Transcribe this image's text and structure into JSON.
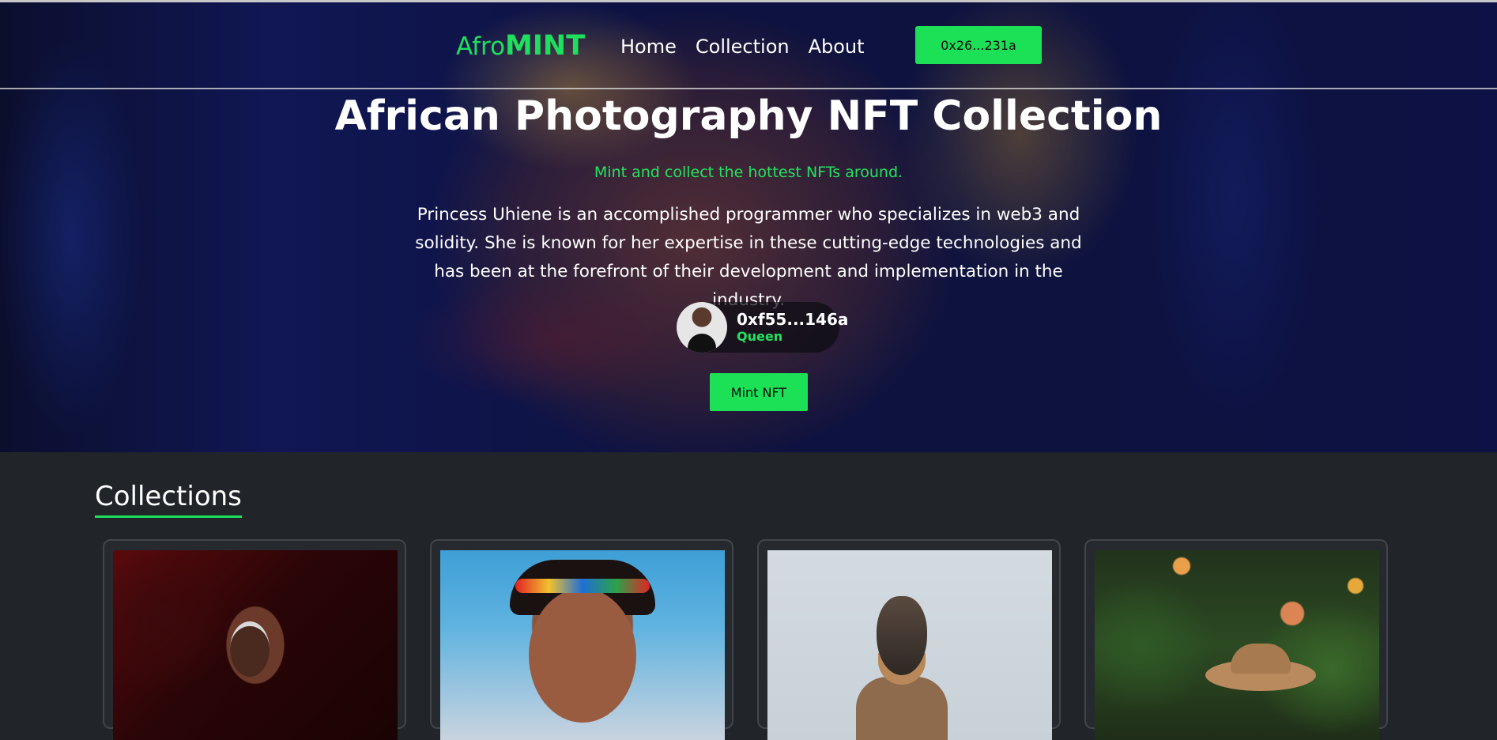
{
  "navbar": {
    "brand_part1": "Afro",
    "brand_part2": "MINT",
    "links": [
      "Home",
      "Collection",
      "About"
    ],
    "wallet_button_label": "0x26...231a"
  },
  "hero": {
    "title": "African Photography NFT Collection",
    "subtitle": "Mint and collect the hottest NFTs around.",
    "description": "Princess Uhiene is an accomplished programmer who specializes in web3 and solidity. She is known for her expertise in these cutting-edge technologies and has been at the forefront of their development and implementation in the industry.",
    "owner_address": "0xf55...146a",
    "owner_name": "Queen",
    "mint_button_label": "Mint NFT"
  },
  "collections": {
    "heading": "Collections"
  },
  "colors": {
    "accent": "#1ce157",
    "page_background": "#212529"
  }
}
